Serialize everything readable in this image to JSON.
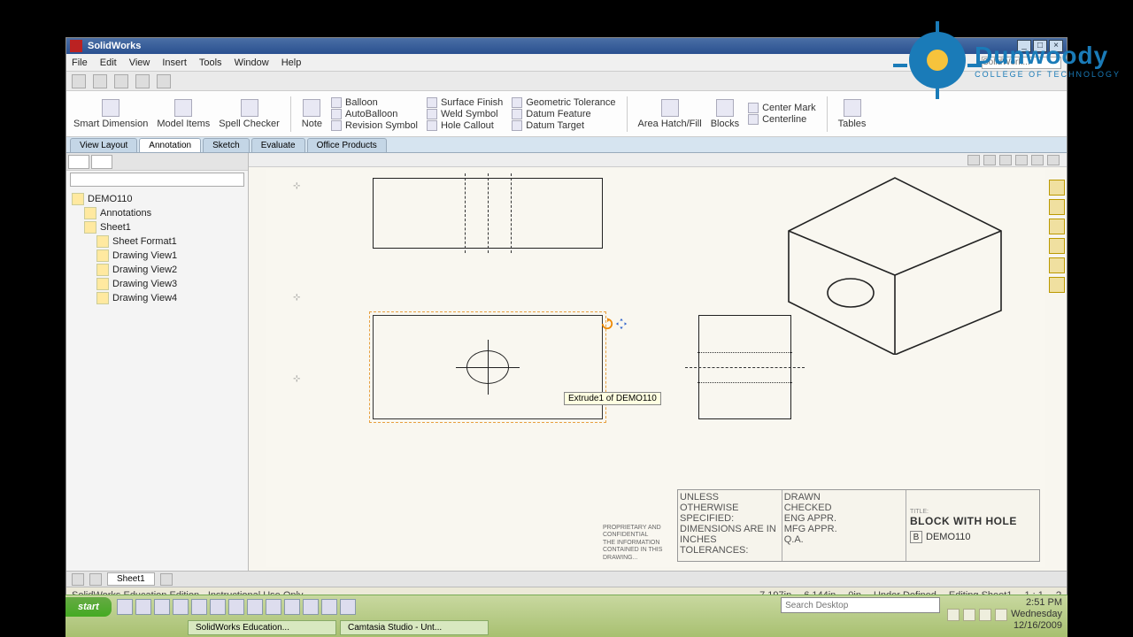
{
  "app": {
    "title": "SolidWorks",
    "search_placeholder": "SolidWork..."
  },
  "menu": {
    "file": "File",
    "edit": "Edit",
    "view": "View",
    "insert": "Insert",
    "tools": "Tools",
    "window": "Window",
    "help": "Help"
  },
  "ribbon": {
    "smart_dimension": "Smart Dimension",
    "model_items": "Model Items",
    "spell_checker": "Spell Checker",
    "note": "Note",
    "balloon": "Balloon",
    "autoballoon": "AutoBalloon",
    "revision_symbol": "Revision Symbol",
    "surface_finish": "Surface Finish",
    "weld_symbol": "Weld Symbol",
    "hole_callout": "Hole Callout",
    "geometric_tolerance": "Geometric Tolerance",
    "datum_feature": "Datum Feature",
    "datum_target": "Datum Target",
    "area_hatch": "Area Hatch/Fill",
    "blocks": "Blocks",
    "center_mark": "Center Mark",
    "centerline": "Centerline",
    "tables": "Tables"
  },
  "tabs": {
    "view_layout": "View Layout",
    "annotation": "Annotation",
    "sketch": "Sketch",
    "evaluate": "Evaluate",
    "office_products": "Office Products"
  },
  "tree": {
    "root": "DEMO110",
    "annotations": "Annotations",
    "sheet": "Sheet1",
    "sheet_format": "Sheet Format1",
    "view1": "Drawing View1",
    "view2": "Drawing View2",
    "view3": "Drawing View3",
    "view4": "Drawing View4"
  },
  "canvas": {
    "tooltip": "Extrude1 of DEMO110"
  },
  "titleblock": {
    "title": "BLOCK WITH HOLE",
    "size": "B",
    "number": "DEMO110"
  },
  "sheet_tabs": {
    "sheet1": "Sheet1"
  },
  "status": {
    "edition": "SolidWorks Education Edition - Instructional Use Only",
    "x": "7.197in",
    "y": "6.144in",
    "z": "0in",
    "defined": "Under Defined",
    "editing": "Editing Sheet1",
    "scale": "1 : 1"
  },
  "taskbar": {
    "start": "start",
    "task1": "SolidWorks Education...",
    "task2": "Camtasia Studio - Unt...",
    "search_placeholder": "Search Desktop",
    "time": "2:51 PM",
    "day": "Wednesday",
    "date": "12/16/2009"
  },
  "logo": {
    "name": "Dunwoody",
    "sub": "COLLEGE OF TECHNOLOGY"
  }
}
